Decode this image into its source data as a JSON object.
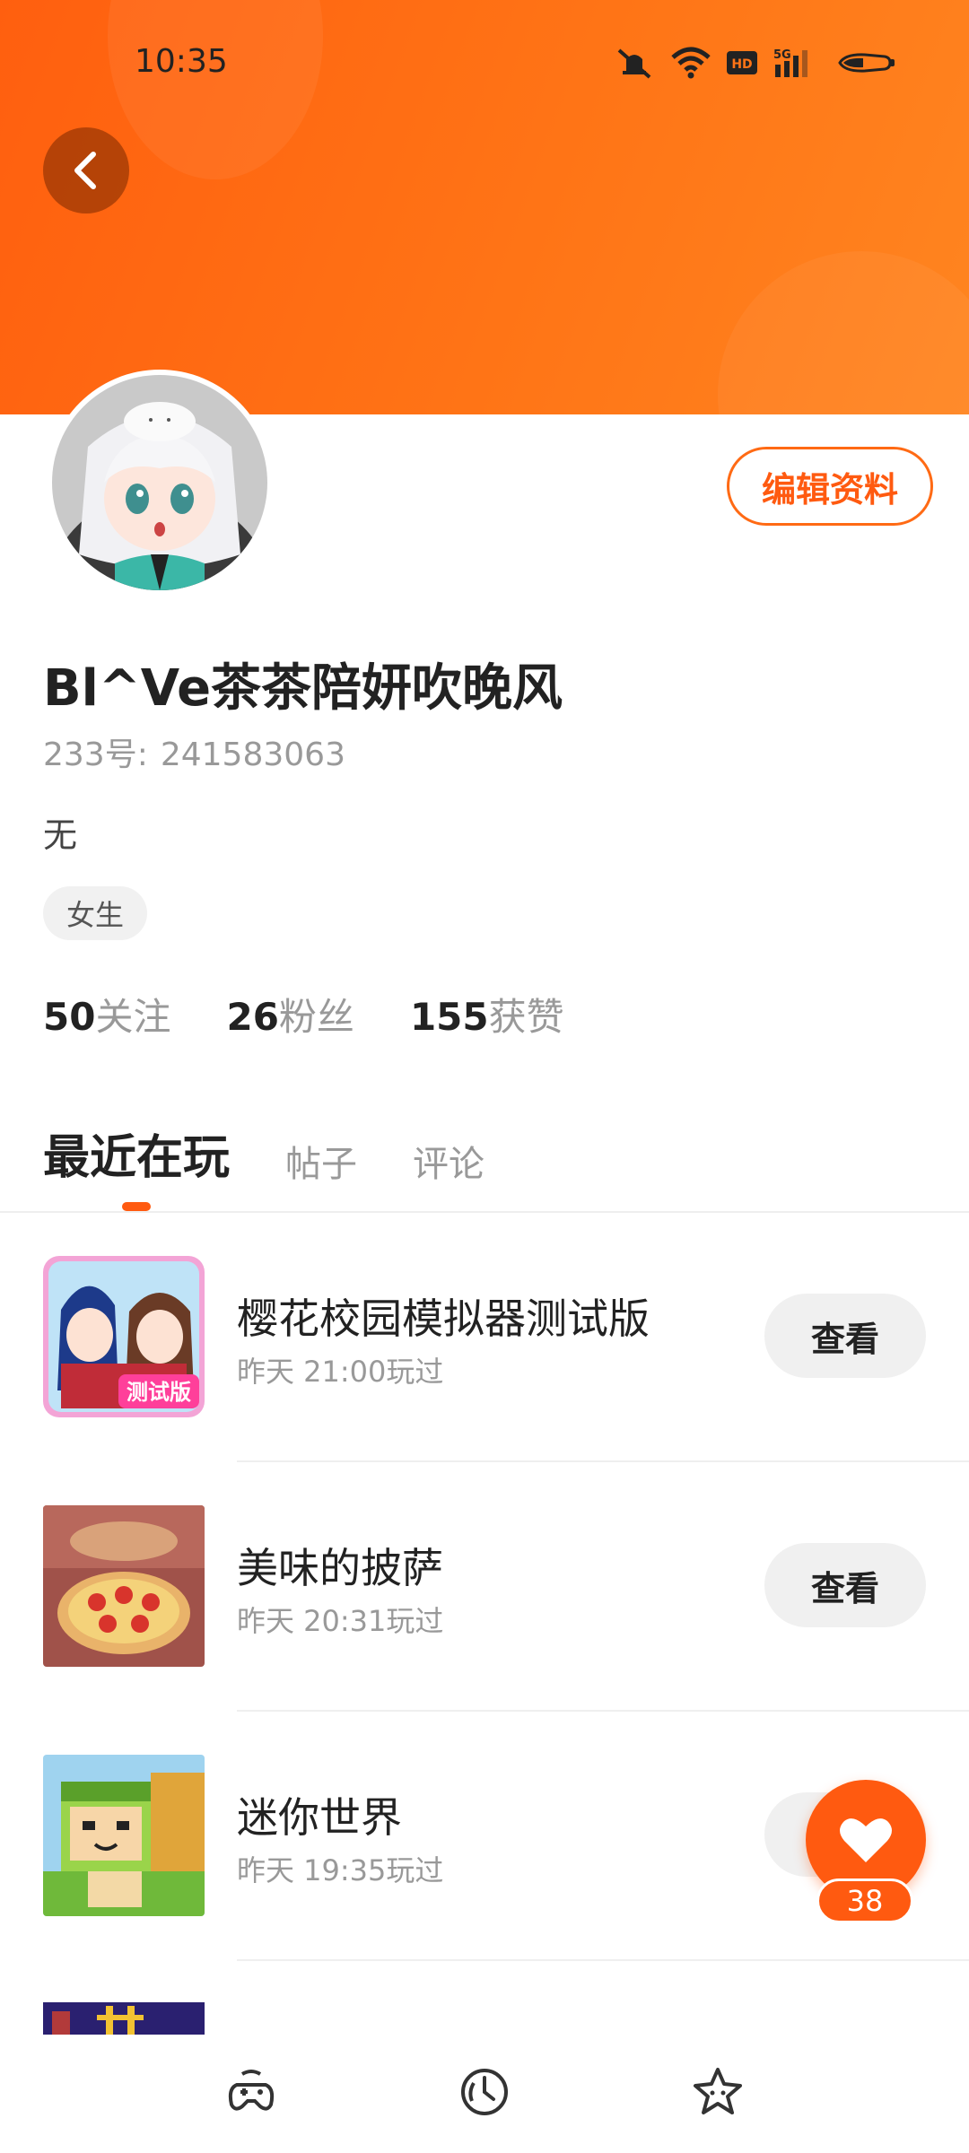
{
  "status_bar": {
    "time": "10:35"
  },
  "profile": {
    "edit_label": "编辑资料",
    "username": "Bl^Ve茶茶陪妍吹晚风",
    "id_label": "233号:",
    "id_value": "241583063",
    "bio": "无",
    "tag": "女生",
    "stats": [
      {
        "value": "50",
        "label": "关注"
      },
      {
        "value": "26",
        "label": "粉丝"
      },
      {
        "value": "155",
        "label": "获赞"
      }
    ]
  },
  "tabs": [
    {
      "label": "最近在玩",
      "active": true
    },
    {
      "label": "帖子",
      "active": false
    },
    {
      "label": "评论",
      "active": false
    }
  ],
  "games": [
    {
      "title": "樱花校园模拟器测试版",
      "played": "昨天 21:00玩过",
      "button": "查看",
      "icon_badge": "测试版"
    },
    {
      "title": "美味的披萨",
      "played": "昨天 20:31玩过",
      "button": "查看"
    },
    {
      "title": "迷你世界",
      "played": "昨天 19:35玩过",
      "button": "查看"
    }
  ],
  "like_fab": {
    "count": "38"
  },
  "colors": {
    "accent": "#ff5a10",
    "header_start": "#ff5f0f",
    "header_end": "#ff8520"
  }
}
